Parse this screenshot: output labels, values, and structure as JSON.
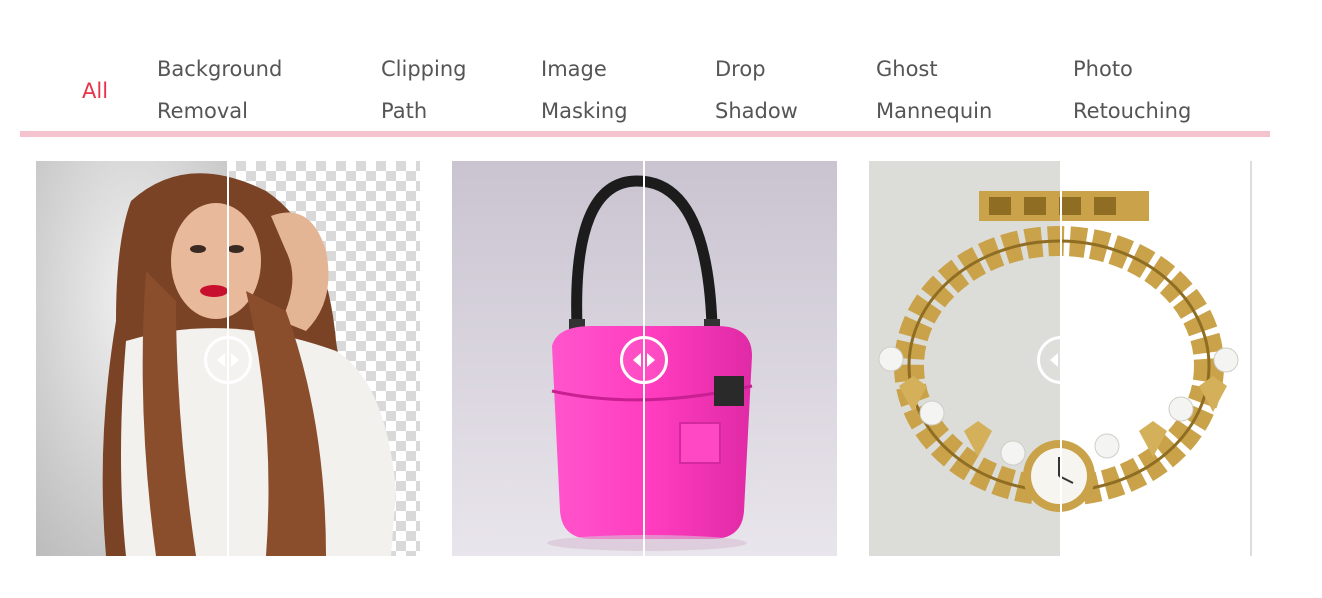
{
  "filter_tabs": [
    {
      "line1": "All",
      "line2": "",
      "active": true
    },
    {
      "line1": "Background",
      "line2": "Removal",
      "active": false
    },
    {
      "line1": "Clipping",
      "line2": "Path",
      "active": false
    },
    {
      "line1": "Image",
      "line2": "Masking",
      "active": false
    },
    {
      "line1": "Drop",
      "line2": "Shadow",
      "active": false
    },
    {
      "line1": "Ghost",
      "line2": "Mannequin",
      "active": false
    },
    {
      "line1": "Photo",
      "line2": "Retouching",
      "active": false
    }
  ],
  "colors": {
    "active_tab": "#e8334a",
    "tab_text": "#555555",
    "tab_rule": "#f4c3cd",
    "bag_pink": "#ff3cbf",
    "gold": "#c9a24a"
  },
  "gallery": [
    {
      "subject": "woman with long hair",
      "before": "grey studio background",
      "after": "transparent checkerboard",
      "divider_fraction": 0.5
    },
    {
      "subject": "pink handbag",
      "before": "lavender background",
      "after": "lavender background",
      "divider_fraction": 0.5
    },
    {
      "subject": "gold bracelet watch",
      "before": "grey background",
      "after": "white background",
      "divider_fraction": 0.5
    }
  ]
}
